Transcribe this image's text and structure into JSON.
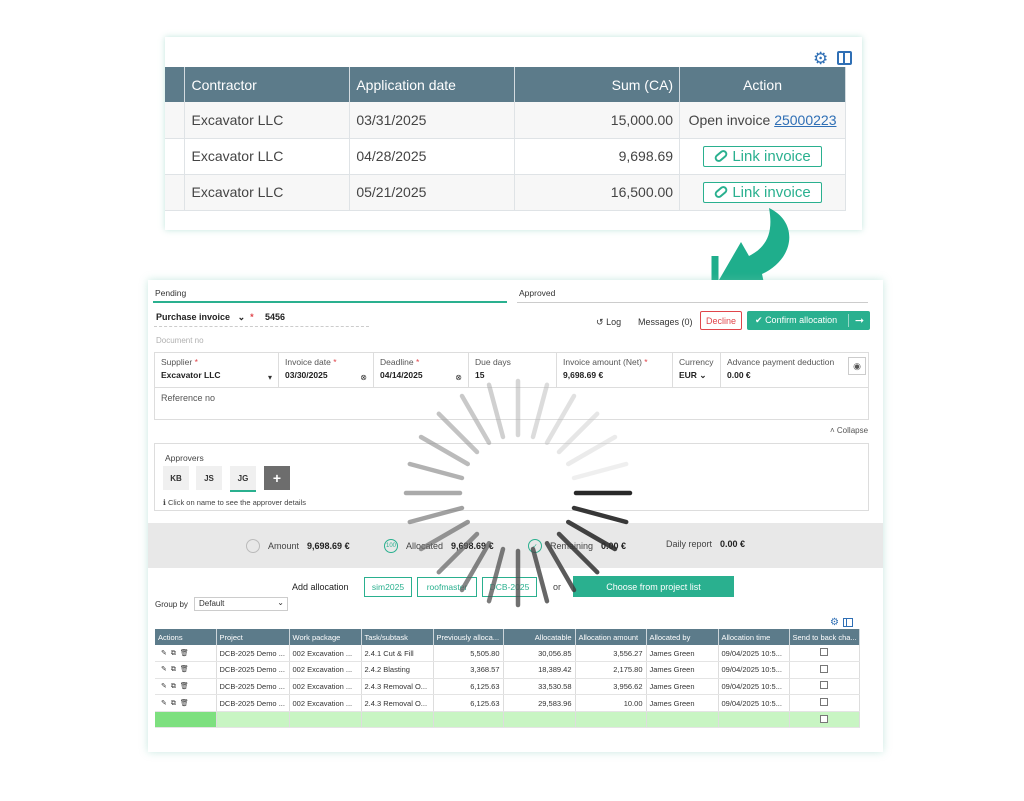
{
  "top": {
    "columns": [
      "Contractor",
      "Application date",
      "Sum (CA)",
      "Action"
    ],
    "rows": [
      {
        "contractor": "Excavator LLC",
        "date": "03/31/2025",
        "sum": "15,000.00",
        "action_text": "Open invoice",
        "action_link": "25000223"
      },
      {
        "contractor": "Excavator LLC",
        "date": "04/28/2025",
        "sum": "9,698.69",
        "action_button": "Link invoice"
      },
      {
        "contractor": "Excavator LLC",
        "date": "05/21/2025",
        "sum": "16,500.00",
        "action_button": "Link invoice"
      }
    ]
  },
  "tabs": {
    "pending": "Pending",
    "approved": "Approved"
  },
  "header": {
    "type_label": "Purchase invoice",
    "doc_number": "5456",
    "doc_no_placeholder": "Document no",
    "log": "Log",
    "messages": "Messages (0)",
    "decline": "Decline",
    "confirm": "Confirm allocation"
  },
  "fields": {
    "supplier_label": "Supplier",
    "supplier": "Excavator LLC",
    "invoice_date_label": "Invoice date",
    "invoice_date": "03/30/2025",
    "deadline_label": "Deadline",
    "deadline": "04/14/2025",
    "due_days_label": "Due days",
    "due_days": "15",
    "amount_label": "Invoice amount (Net)",
    "amount": "9,698.69 €",
    "currency_label": "Currency",
    "currency": "EUR",
    "advance_label": "Advance payment deduction",
    "advance": "0.00 €",
    "reference_label": "Reference no",
    "collapse": "Collapse"
  },
  "approvers": {
    "title": "Approvers",
    "chips": [
      "KB",
      "JS",
      "JG"
    ],
    "add": "+",
    "hint": "Click on name to see the approver details"
  },
  "summary": {
    "amount_label": "Amount",
    "amount": "9,698.69 €",
    "allocated_label": "Allocated",
    "allocated": "9,698.69 €",
    "allocated_badge": "100",
    "remaining_label": "Remaining",
    "remaining": "0.00 €",
    "daily_label": "Daily report",
    "daily": "0.00 €"
  },
  "allocation": {
    "label": "Add allocation",
    "tags": [
      "sim2025",
      "roofmaster",
      "DCB-2025"
    ],
    "or": "or",
    "choose": "Choose from project list",
    "group_by_label": "Group by",
    "group_by_value": "Default"
  },
  "grid": {
    "columns": [
      "Actions",
      "Project",
      "Work package",
      "Task/subtask",
      "Previously alloca...",
      "Allocatable",
      "Allocation amount",
      "Allocated by",
      "Allocation time",
      "Send to back cha..."
    ],
    "rows": [
      [
        "DCB-2025 Demo ...",
        "002 Excavation ...",
        "2.4.1 Cut & Fill",
        "5,505.80",
        "30,056.85",
        "3,556.27",
        "James Green",
        "09/04/2025 10:5..."
      ],
      [
        "DCB-2025 Demo ...",
        "002 Excavation ...",
        "2.4.2 Blasting",
        "3,368.57",
        "18,389.42",
        "2,175.80",
        "James Green",
        "09/04/2025 10:5..."
      ],
      [
        "DCB-2025 Demo ...",
        "002 Excavation ...",
        "2.4.3 Removal O...",
        "6,125.63",
        "33,530.58",
        "3,956.62",
        "James Green",
        "09/04/2025 10:5..."
      ],
      [
        "DCB-2025 Demo ...",
        "002 Excavation ...",
        "2.4.3 Removal O...",
        "6,125.63",
        "29,583.96",
        "10.00",
        "James Green",
        "09/04/2025 10:5..."
      ]
    ]
  },
  "colors": {
    "accent": "#2ab08f",
    "header": "#5c7b8a",
    "danger": "#e0454b",
    "link": "#2f6fb5"
  }
}
